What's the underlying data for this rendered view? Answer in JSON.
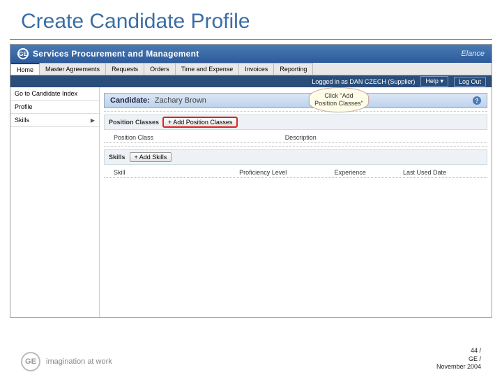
{
  "slide": {
    "title": "Create Candidate Profile"
  },
  "header": {
    "app_title": "Services Procurement and Management",
    "brand_right": "Elance"
  },
  "tabs": [
    {
      "label": "Home",
      "active": true
    },
    {
      "label": "Master Agreements",
      "active": false
    },
    {
      "label": "Requests",
      "active": false
    },
    {
      "label": "Orders",
      "active": false
    },
    {
      "label": "Time and Expense",
      "active": false
    },
    {
      "label": "Invoices",
      "active": false
    },
    {
      "label": "Reporting",
      "active": false
    }
  ],
  "status": {
    "logged_in": "Logged in as DAN CZECH (Supplier)",
    "help": "Help",
    "logout": "Log Out"
  },
  "sidebar": {
    "items": [
      {
        "label": "Go to Candidate Index",
        "arrow": false
      },
      {
        "label": "Profile",
        "arrow": false
      },
      {
        "label": "Skills",
        "arrow": true
      }
    ]
  },
  "panel": {
    "title_main": "Candidate:",
    "title_sub": "Zachary Brown"
  },
  "callout": {
    "text": "Click \"Add Position Classes\""
  },
  "sections": {
    "position": {
      "label": "Position Classes",
      "button": "+ Add Position Classes",
      "cols": [
        "Position Class",
        "Description"
      ]
    },
    "skills": {
      "label": "Skills",
      "button": "+ Add Skills",
      "cols": [
        "Skill",
        "Proficiency Level",
        "Experience",
        "Last Used Date"
      ]
    }
  },
  "footer": {
    "tagline": "imagination at work",
    "page": "44 /",
    "org": "GE /",
    "date": "November 2004"
  }
}
